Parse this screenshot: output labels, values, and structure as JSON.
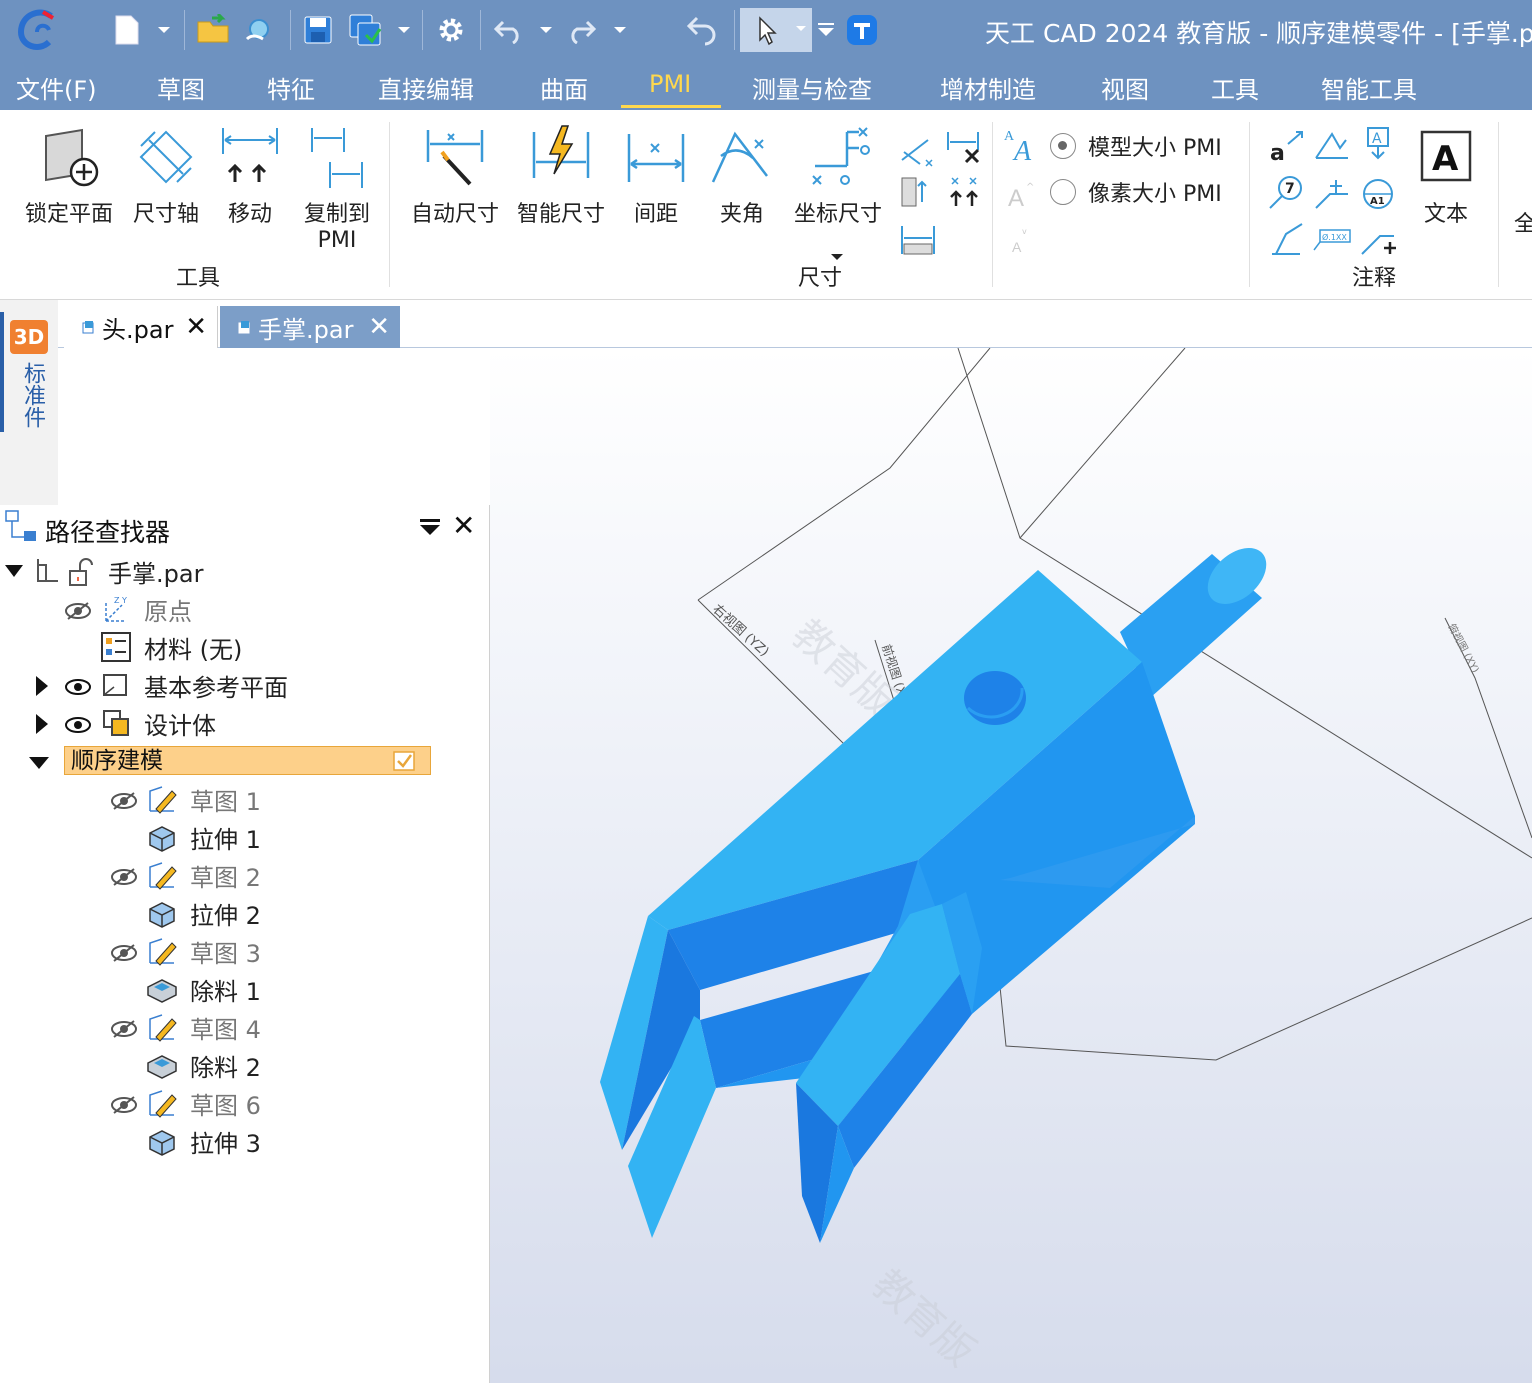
{
  "titlebar": {
    "title": "天工 CAD 2024 教育版 - 顺序建模零件 - [手掌.p",
    "colors": {
      "bar": "#6e92c0",
      "active_menu": "#ffd84d"
    }
  },
  "menu": {
    "items": [
      "文件(F)",
      "草图",
      "特征",
      "直接编辑",
      "曲面",
      "PMI",
      "测量与检查",
      "增材制造",
      "视图",
      "工具",
      "智能工具"
    ],
    "active": "PMI"
  },
  "ribbon": {
    "tools_group": {
      "label": "工具",
      "buttons": [
        "锁定平面",
        "尺寸轴",
        "移动",
        "复制到",
        "PMI"
      ]
    },
    "dimension_group": {
      "label": "尺寸",
      "buttons": [
        "自动尺寸",
        "智能尺寸",
        "间距",
        "夹角",
        "坐标尺寸"
      ],
      "radio_model": "模型大小 PMI",
      "radio_pixel": "像素大小 PMI",
      "radio_selected": "模型大小 PMI"
    },
    "annotation_group": {
      "label": "注释",
      "text_button": "文本",
      "cut_off": "全",
      "icon_letters": {
        "a": "a",
        "seven": "7",
        "a1": "A1",
        "A": "A",
        "fcf": "Ø.1XX"
      }
    }
  },
  "left_strip": {
    "badge": "3D",
    "label": "标准件"
  },
  "tabs": [
    {
      "label": "头.par",
      "active": false
    },
    {
      "label": "手掌.par",
      "active": true
    }
  ],
  "pathfinder": {
    "title": "路径查找器",
    "root": "手掌.par",
    "items": {
      "origin": "原点",
      "material": "材料 (无)",
      "base_planes": "基本参考平面",
      "design_body": "设计体",
      "sequential": "顺序建模",
      "sketch1": "草图 1",
      "extrude1": "拉伸 1",
      "sketch2": "草图 2",
      "extrude2": "拉伸 2",
      "sketch3": "草图 3",
      "cut1": "除料 1",
      "sketch4": "草图 4",
      "cut2": "除料 2",
      "sketch6": "草图 6",
      "extrude3": "拉伸 3"
    }
  },
  "viewport": {
    "watermark": "教育版",
    "plane_right": "右视图 (YZ)",
    "plane_front": "前视图 (XZ)",
    "plane_top": "俯视图 (XY)",
    "colors": {
      "part_light": "#33b3f3",
      "part_mid": "#2196f0",
      "part_dark": "#1a78df"
    }
  }
}
